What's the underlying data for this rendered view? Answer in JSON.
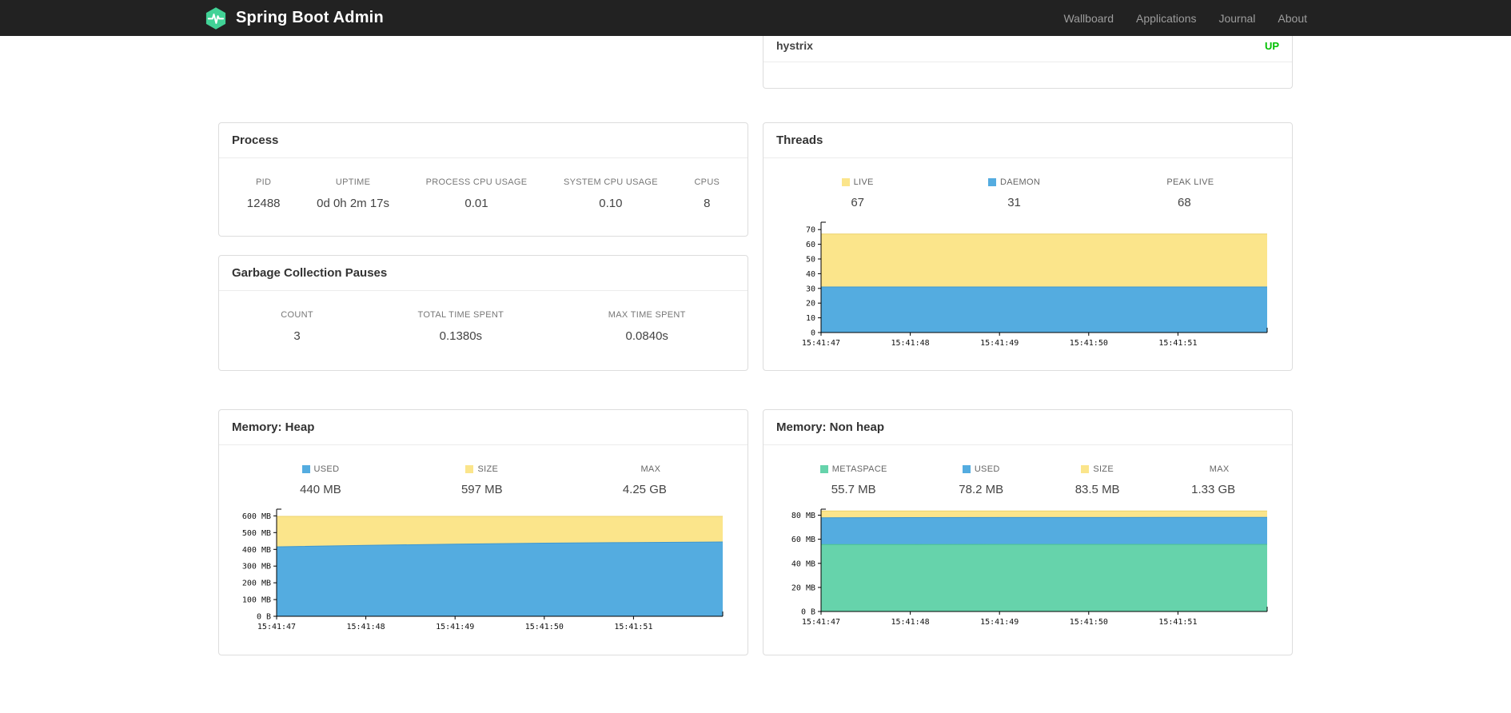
{
  "navbar": {
    "brand": "Spring Boot Admin",
    "items": [
      "Wallboard",
      "Applications",
      "Journal",
      "About"
    ]
  },
  "colors": {
    "status_up": "#00c000",
    "chart_blue": "#54ace0",
    "chart_yellow": "#fbe58b",
    "chart_green": "#66d3ab",
    "brand_green": "#41d296"
  },
  "health": {
    "service": "hystrix",
    "status": "UP"
  },
  "process": {
    "title": "Process",
    "metrics": [
      {
        "label": "PID",
        "value": "12488"
      },
      {
        "label": "UPTIME",
        "value": "0d 0h 2m 17s"
      },
      {
        "label": "PROCESS CPU USAGE",
        "value": "0.01"
      },
      {
        "label": "SYSTEM CPU USAGE",
        "value": "0.10"
      },
      {
        "label": "CPUS",
        "value": "8"
      }
    ]
  },
  "gc": {
    "title": "Garbage Collection Pauses",
    "metrics": [
      {
        "label": "COUNT",
        "value": "3"
      },
      {
        "label": "TOTAL TIME SPENT",
        "value": "0.1380s"
      },
      {
        "label": "MAX TIME SPENT",
        "value": "0.0840s"
      }
    ]
  },
  "threads": {
    "title": "Threads",
    "legend": [
      {
        "label": "LIVE",
        "value": "67",
        "swatch": "#fbe58b"
      },
      {
        "label": "DAEMON",
        "value": "31",
        "swatch": "#54ace0"
      },
      {
        "label": "PEAK LIVE",
        "value": "68",
        "swatch": null
      }
    ]
  },
  "heap": {
    "title": "Memory: Heap",
    "legend": [
      {
        "label": "USED",
        "value": "440 MB",
        "swatch": "#54ace0"
      },
      {
        "label": "SIZE",
        "value": "597 MB",
        "swatch": "#fbe58b"
      },
      {
        "label": "MAX",
        "value": "4.25 GB",
        "swatch": null
      }
    ]
  },
  "nonheap": {
    "title": "Memory: Non heap",
    "legend": [
      {
        "label": "METASPACE",
        "value": "55.7 MB",
        "swatch": "#66d3ab"
      },
      {
        "label": "USED",
        "value": "78.2 MB",
        "swatch": "#54ace0"
      },
      {
        "label": "SIZE",
        "value": "83.5 MB",
        "swatch": "#fbe58b"
      },
      {
        "label": "MAX",
        "value": "1.33 GB",
        "swatch": null
      }
    ]
  },
  "chart_data": [
    {
      "id": "threads",
      "type": "area",
      "title": "Threads",
      "x": [
        "15:41:47",
        "15:41:48",
        "15:41:49",
        "15:41:50",
        "15:41:51"
      ],
      "ylim": [
        0,
        75
      ],
      "y_ticks": [
        0,
        10,
        20,
        30,
        40,
        50,
        60,
        70
      ],
      "y_tick_labels": [
        "0",
        "10",
        "20",
        "30",
        "40",
        "50",
        "60",
        "70"
      ],
      "legend_position": "top",
      "grid": false,
      "series": [
        {
          "name": "LIVE",
          "color": "#fbe58b",
          "stroke": "#ecd26b",
          "values": [
            67,
            67,
            67,
            67,
            67,
            67
          ]
        },
        {
          "name": "DAEMON",
          "color": "#54ace0",
          "stroke": "#3f97cf",
          "values": [
            31,
            31,
            31,
            31,
            31,
            31
          ]
        }
      ]
    },
    {
      "id": "heap",
      "type": "area",
      "title": "Memory: Heap",
      "x": [
        "15:41:47",
        "15:41:48",
        "15:41:49",
        "15:41:50",
        "15:41:51"
      ],
      "ylim": [
        0,
        640
      ],
      "y_ticks": [
        0,
        100,
        200,
        300,
        400,
        500,
        600
      ],
      "y_tick_labels": [
        "0 B",
        "100 MB",
        "200 MB",
        "300 MB",
        "400 MB",
        "500 MB",
        "600 MB"
      ],
      "legend_position": "top",
      "grid": false,
      "series": [
        {
          "name": "SIZE",
          "color": "#fbe58b",
          "stroke": "#ecd26b",
          "values": [
            597,
            597,
            597,
            597,
            597,
            597
          ]
        },
        {
          "name": "USED",
          "color": "#54ace0",
          "stroke": "#3f97cf",
          "values": [
            415,
            424,
            431,
            437,
            441,
            444
          ]
        }
      ]
    },
    {
      "id": "nonheap",
      "type": "area",
      "title": "Memory: Non heap",
      "x": [
        "15:41:47",
        "15:41:48",
        "15:41:49",
        "15:41:50",
        "15:41:51"
      ],
      "ylim": [
        0,
        85
      ],
      "y_ticks": [
        0,
        20,
        40,
        60,
        80
      ],
      "y_tick_labels": [
        "0 B",
        "20 MB",
        "40 MB",
        "60 MB",
        "80 MB"
      ],
      "legend_position": "top",
      "grid": false,
      "series": [
        {
          "name": "SIZE",
          "color": "#fbe58b",
          "stroke": "#ecd26b",
          "values": [
            83.5,
            83.5,
            83.5,
            83.5,
            83.5,
            83.5
          ]
        },
        {
          "name": "USED",
          "color": "#54ace0",
          "stroke": "#3f97cf",
          "values": [
            77.9,
            78.0,
            78.1,
            78.1,
            78.2,
            78.2
          ]
        },
        {
          "name": "METASPACE",
          "color": "#66d3ab",
          "stroke": "#4cc192",
          "values": [
            55.6,
            55.6,
            55.7,
            55.7,
            55.7,
            55.7
          ]
        }
      ]
    }
  ]
}
